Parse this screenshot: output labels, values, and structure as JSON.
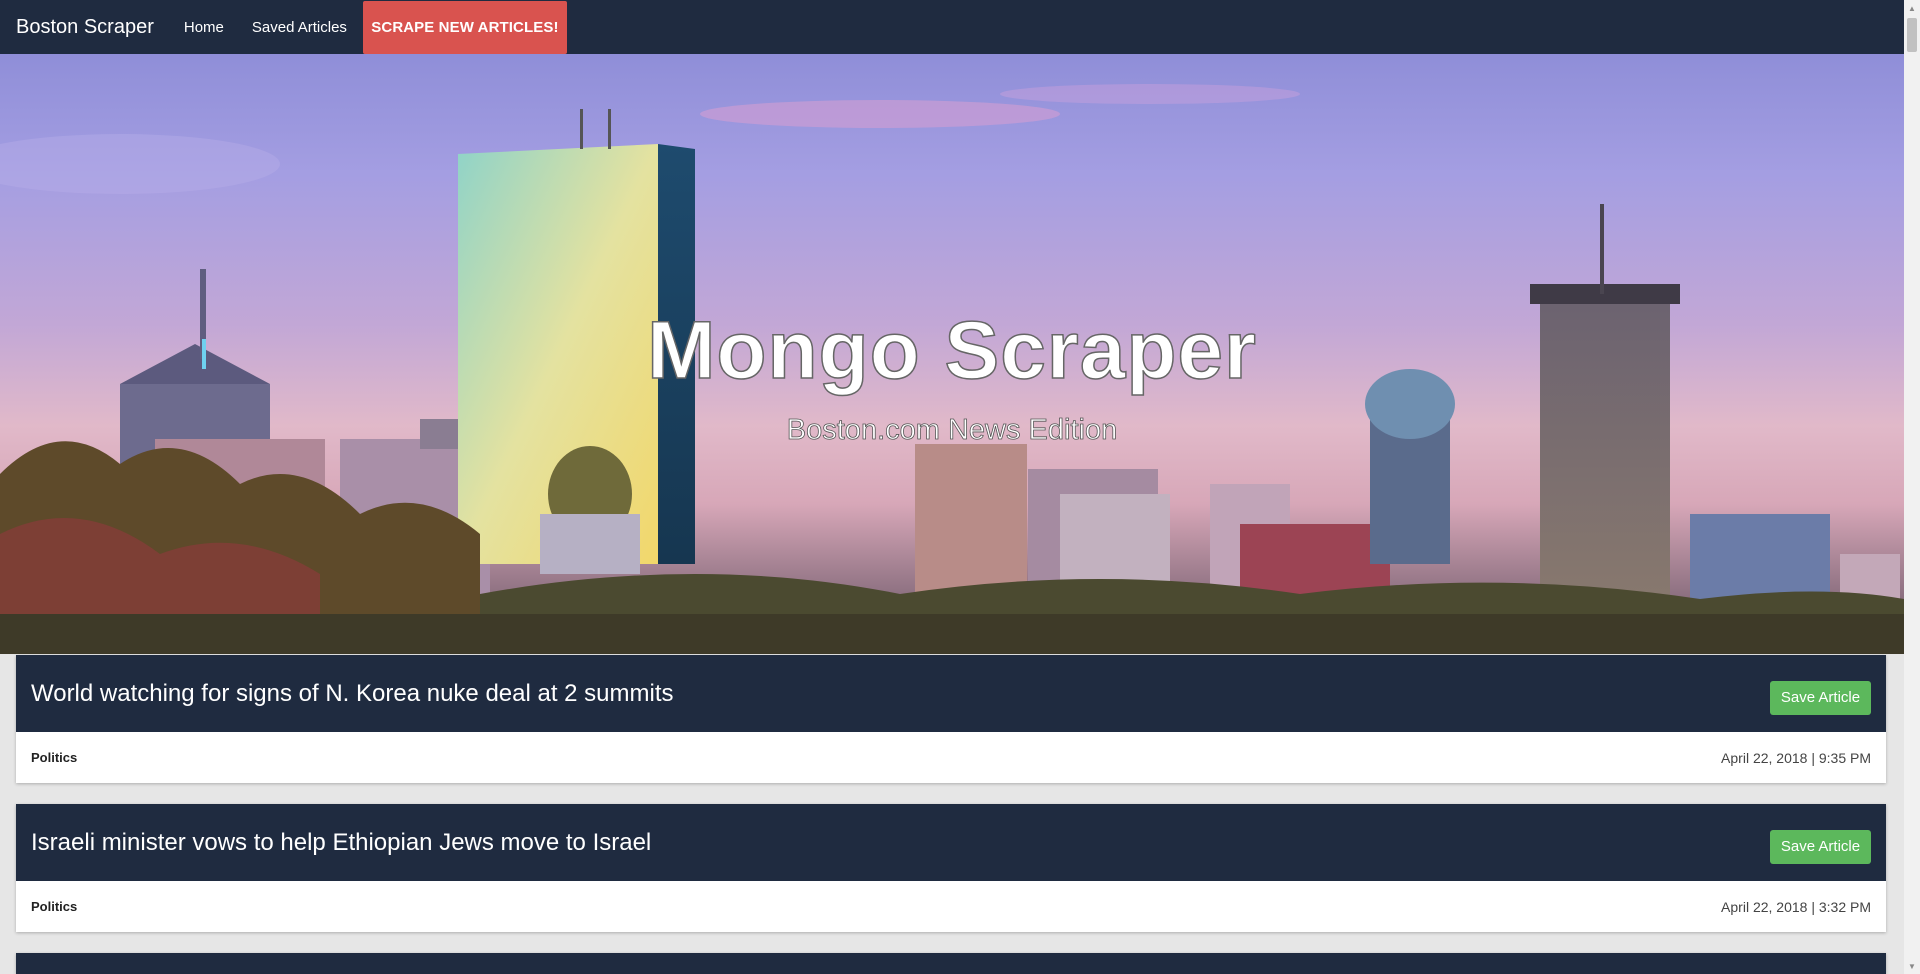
{
  "nav": {
    "brand": "Boston Scraper",
    "home": "Home",
    "saved": "Saved Articles",
    "scrape": "SCRAPE NEW ARTICLES!"
  },
  "hero": {
    "title": "Mongo Scraper",
    "subtitle": "Boston.com News Edition"
  },
  "articles": [
    {
      "title": "World watching for signs of N. Korea nuke deal at 2 summits",
      "save_label": "Save Article",
      "category": "Politics",
      "date": "April 22, 2018 | 9:35 PM"
    },
    {
      "title": "Israeli minister vows to help Ethiopian Jews move to Israel",
      "save_label": "Save Article",
      "category": "Politics",
      "date": "April 22, 2018 | 3:32 PM"
    }
  ],
  "colors": {
    "navbar": "#1f2b40",
    "scrape_button": "#d9534f",
    "save_button": "#5cb85c"
  }
}
